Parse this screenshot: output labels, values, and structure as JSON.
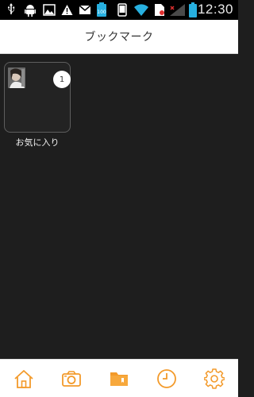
{
  "status_bar": {
    "time": "12:30",
    "icons": [
      "usb-icon",
      "android-debug-icon",
      "image-icon",
      "warning-icon",
      "gmail-icon",
      "battery-100-icon",
      "phone-icon",
      "wifi-icon",
      "sim-icon",
      "signal-icon",
      "battery-icon"
    ],
    "battery_label": "100"
  },
  "header": {
    "title": "ブックマーク"
  },
  "folders": [
    {
      "label": "お気に入り",
      "count": "1"
    }
  ],
  "bottom_nav": {
    "items": [
      "home-icon",
      "camera-icon",
      "bookmark-folder-icon",
      "history-clock-icon",
      "settings-gear-icon"
    ],
    "active_index": 2,
    "accent_color": "#f39a2a"
  }
}
